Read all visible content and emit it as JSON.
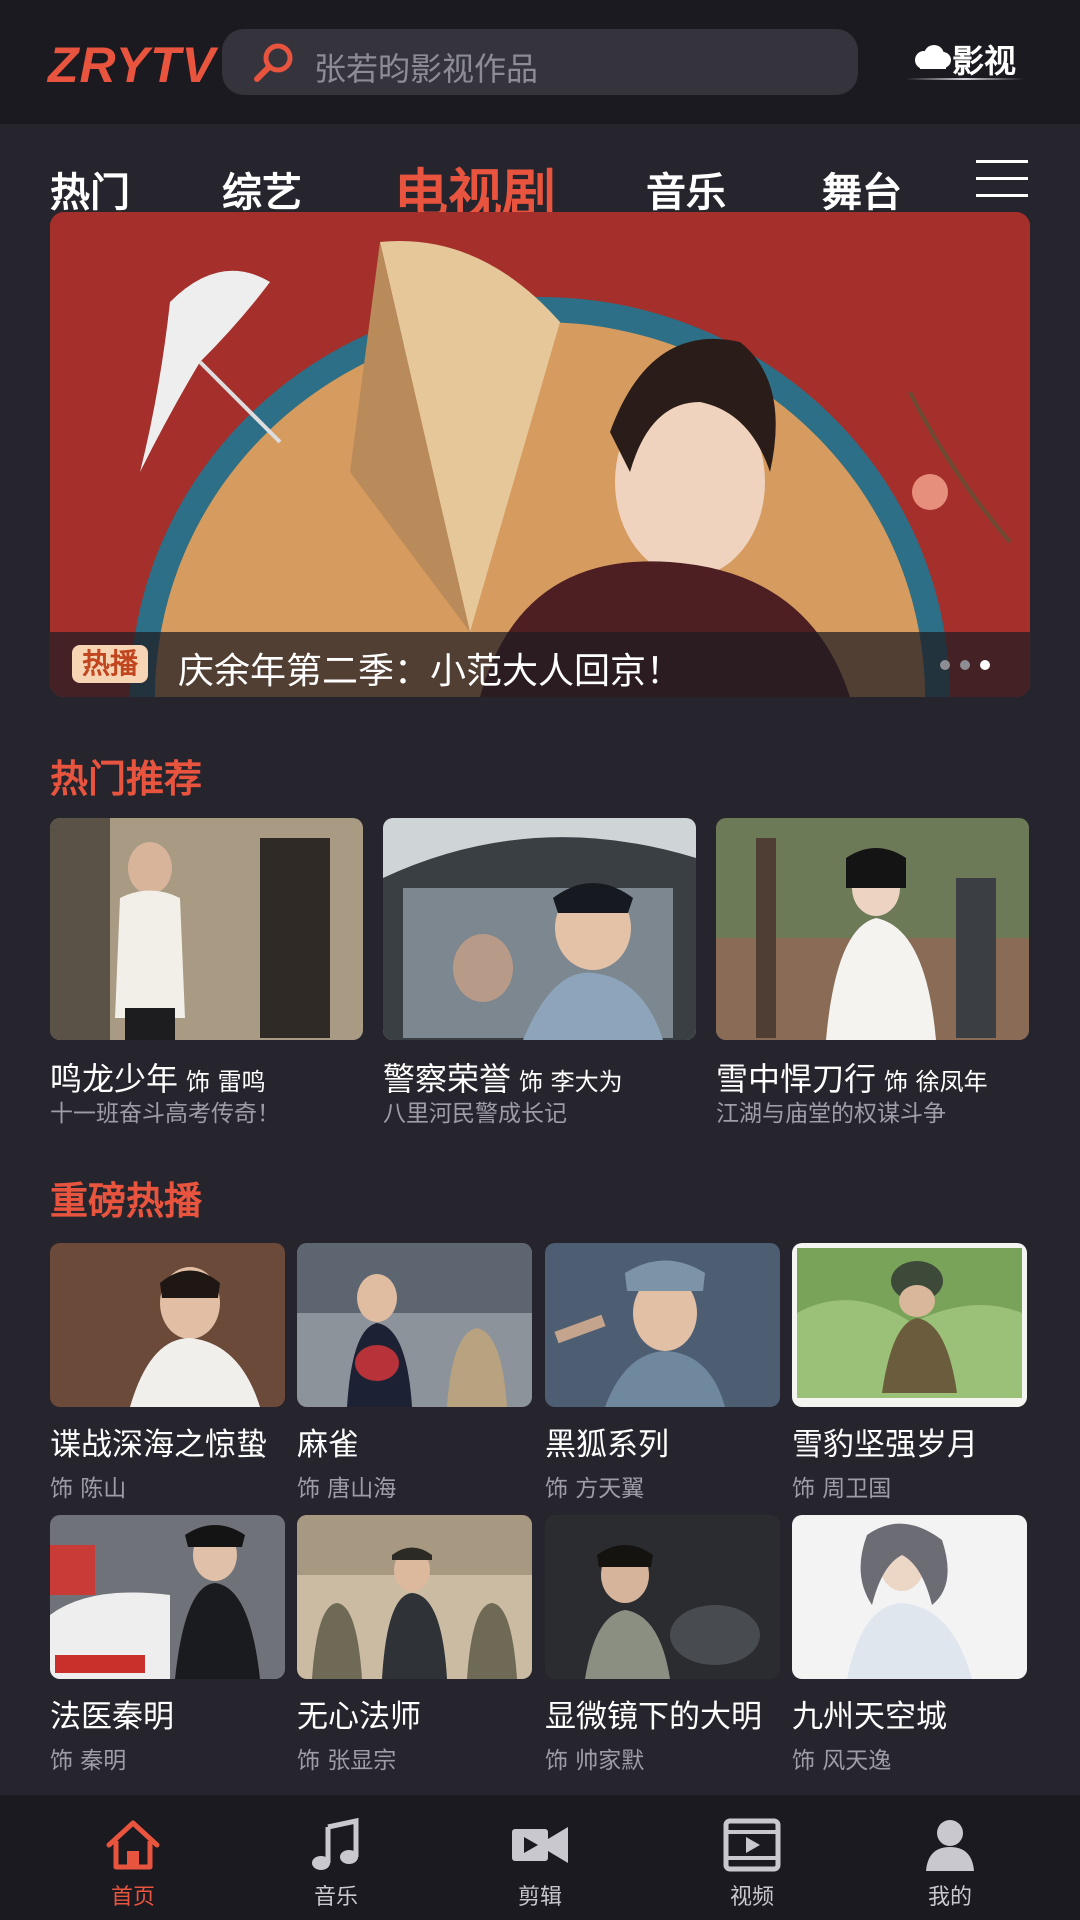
{
  "app": {
    "logo": "ZRYTV",
    "brand": "影视"
  },
  "search": {
    "placeholder": "张若昀影视作品"
  },
  "tabs": [
    {
      "label": "热门"
    },
    {
      "label": "综艺"
    },
    {
      "label": "电视剧",
      "active": true
    },
    {
      "label": "音乐"
    },
    {
      "label": "舞台"
    }
  ],
  "banner": {
    "badge": "热播",
    "title": "庆余年第二季：小范大人回京！",
    "page_count": 3,
    "active_page": 3
  },
  "hot": {
    "title": "热门推荐",
    "items": [
      {
        "title": "鸣龙少年",
        "role": "饰 雷鸣",
        "desc": "十一班奋斗高考传奇！"
      },
      {
        "title": "警察荣誉",
        "role": "饰 李大为",
        "desc": "八里河民警成长记"
      },
      {
        "title": "雪中悍刀行",
        "role": "饰 徐凤年",
        "desc": "江湖与庙堂的权谋斗争"
      }
    ]
  },
  "featured": {
    "title": "重磅热播",
    "items": [
      {
        "title": "谍战深海之惊蛰",
        "role": "饰 陈山"
      },
      {
        "title": "麻雀",
        "role": "饰 唐山海"
      },
      {
        "title": "黑狐系列",
        "role": "饰 方天翼"
      },
      {
        "title": "雪豹坚强岁月",
        "role": "饰 周卫国"
      },
      {
        "title": "法医秦明",
        "role": "饰 秦明"
      },
      {
        "title": "无心法师",
        "role": "饰 张显宗"
      },
      {
        "title": "显微镜下的大明",
        "role": "饰 帅家默"
      },
      {
        "title": "九州天空城",
        "role": "饰 风天逸"
      }
    ]
  },
  "nav": [
    {
      "label": "首页",
      "icon": "home-icon",
      "active": true
    },
    {
      "label": "音乐",
      "icon": "music-note-icon"
    },
    {
      "label": "剪辑",
      "icon": "video-camera-icon"
    },
    {
      "label": "视频",
      "icon": "film-icon"
    },
    {
      "label": "我的",
      "icon": "user-icon"
    }
  ],
  "colors": {
    "accent": "#e9543e",
    "background": "#26252d",
    "bar": "#1a1a20"
  }
}
